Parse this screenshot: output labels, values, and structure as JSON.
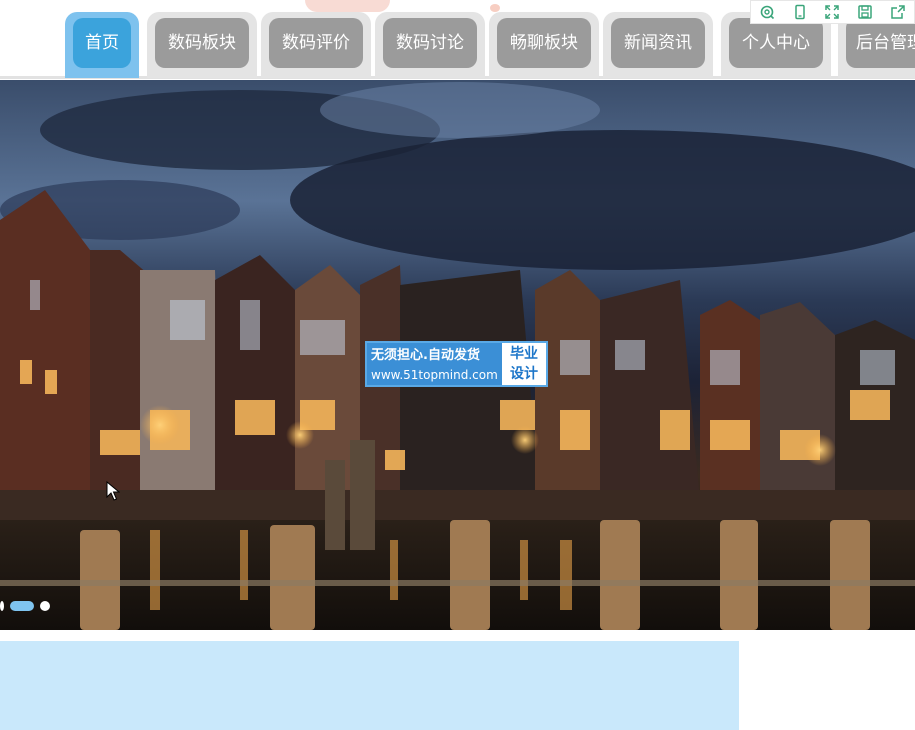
{
  "nav": {
    "tabs": [
      {
        "label": "首页",
        "active": true
      },
      {
        "label": "数码板块",
        "active": false
      },
      {
        "label": "数码评价",
        "active": false
      },
      {
        "label": "数码讨论",
        "active": false
      },
      {
        "label": "畅聊板块",
        "active": false
      },
      {
        "label": "新闻资讯",
        "active": false
      },
      {
        "label": "个人中心",
        "active": false
      },
      {
        "label": "后台管理",
        "active": false
      }
    ]
  },
  "toolbar": {
    "icons": [
      "search-refresh-icon",
      "tablet-icon",
      "fullscreen-icon",
      "save-icon",
      "share-icon"
    ],
    "icon_color": "#3aa57a"
  },
  "watermark": {
    "slogan": "无须担心.自动发货",
    "url": "www.51topmind.com",
    "tag_line1": "毕业",
    "tag_line2": "设计"
  },
  "carousel": {
    "slide_count": 3,
    "active_index": 1
  },
  "colors": {
    "active_tab": "#3ba3dc",
    "inactive_tab": "#9b9b9b",
    "panel": "#c9e8fb"
  }
}
